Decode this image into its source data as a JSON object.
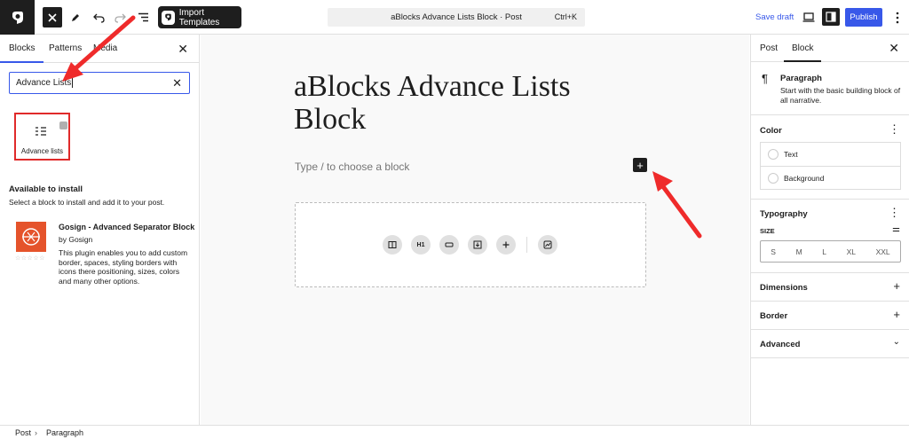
{
  "topbar": {
    "import_label": "Import Templates",
    "command_title": "aBlocks Advance Lists Block · Post",
    "command_shortcut": "Ctrl+K",
    "save_draft": "Save draft",
    "publish": "Publish"
  },
  "inserter": {
    "tabs": [
      "Blocks",
      "Patterns",
      "Media"
    ],
    "search_value": "Advance Lists",
    "result_block": "Advance lists",
    "available_title": "Available to install",
    "available_desc": "Select a block to install and add it to your post.",
    "plugin": {
      "name": "Gosign - Advanced Separator Block",
      "author": "by Gosign",
      "description": "This plugin enables you to add custom border, spaces, styling borders with icons there positioning, sizes, colors and many other options."
    }
  },
  "editor": {
    "title": "aBlocks Advance Lists Block",
    "placeholder": "Type / to choose a block",
    "pattern_buttons": [
      "columns",
      "H1",
      "button",
      "download",
      "add",
      "chart"
    ]
  },
  "settings": {
    "tabs": [
      "Post",
      "Block"
    ],
    "block_name": "Paragraph",
    "block_desc": "Start with the basic building block of all narrative.",
    "color_title": "Color",
    "color_items": [
      "Text",
      "Background"
    ],
    "typography_title": "Typography",
    "size_label": "SIZE",
    "sizes": [
      "S",
      "M",
      "L",
      "XL",
      "XXL"
    ],
    "dimensions": "Dimensions",
    "border": "Border",
    "advanced": "Advanced"
  },
  "footer": {
    "crumbs": [
      "Post",
      "Paragraph"
    ]
  },
  "colors": {
    "accent": "#3858e9",
    "dark": "#1e1e1e",
    "annotation": "#e02a2a",
    "plugin_thumb": "#e5532b"
  }
}
